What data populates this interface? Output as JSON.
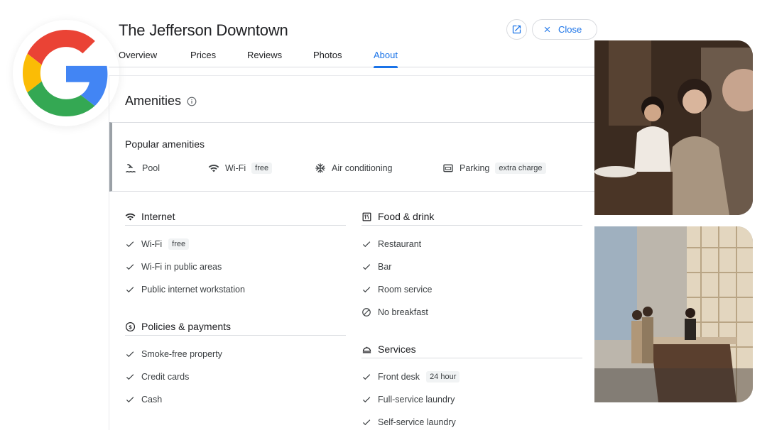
{
  "hotel": {
    "title": "The Jefferson Downtown",
    "close_label": "Close"
  },
  "tabs": [
    {
      "label": "Overview",
      "active": false
    },
    {
      "label": "Prices",
      "active": false
    },
    {
      "label": "Reviews",
      "active": false
    },
    {
      "label": "Photos",
      "active": false
    },
    {
      "label": "About",
      "active": true
    }
  ],
  "amenities": {
    "title": "Amenities",
    "popular": {
      "title": "Popular amenities",
      "items": [
        {
          "icon": "pool-icon",
          "label": "Pool",
          "badge": ""
        },
        {
          "icon": "wifi-icon",
          "label": "Wi-Fi",
          "badge": "free"
        },
        {
          "icon": "snowflake-icon",
          "label": "Air conditioning",
          "badge": ""
        },
        {
          "icon": "parking-icon",
          "label": "Parking",
          "badge": "extra charge"
        }
      ]
    },
    "sections": {
      "internet": {
        "title": "Internet",
        "items": [
          {
            "label": "Wi-Fi",
            "badge": "free",
            "status": "check"
          },
          {
            "label": "Wi-Fi in public areas",
            "badge": "",
            "status": "check"
          },
          {
            "label": "Public internet workstation",
            "badge": "",
            "status": "check"
          }
        ]
      },
      "policies": {
        "title": "Policies & payments",
        "items": [
          {
            "label": "Smoke-free property",
            "status": "check"
          },
          {
            "label": "Credit cards",
            "status": "check"
          },
          {
            "label": "Cash",
            "status": "check"
          }
        ]
      },
      "food": {
        "title": "Food & drink",
        "items": [
          {
            "label": "Restaurant",
            "status": "check"
          },
          {
            "label": "Bar",
            "status": "check"
          },
          {
            "label": "Room service",
            "status": "check"
          },
          {
            "label": "No breakfast",
            "status": "none"
          }
        ]
      },
      "services": {
        "title": "Services",
        "items": [
          {
            "label": "Front desk",
            "badge": "24 hour",
            "status": "check"
          },
          {
            "label": "Full-service laundry",
            "badge": "",
            "status": "check"
          },
          {
            "label": "Self-service laundry",
            "badge": "",
            "status": "check"
          }
        ]
      }
    }
  },
  "colors": {
    "accent": "#1a73e8",
    "text": "#202124",
    "secondary_text": "#3c4043",
    "divider": "#dadce0"
  }
}
